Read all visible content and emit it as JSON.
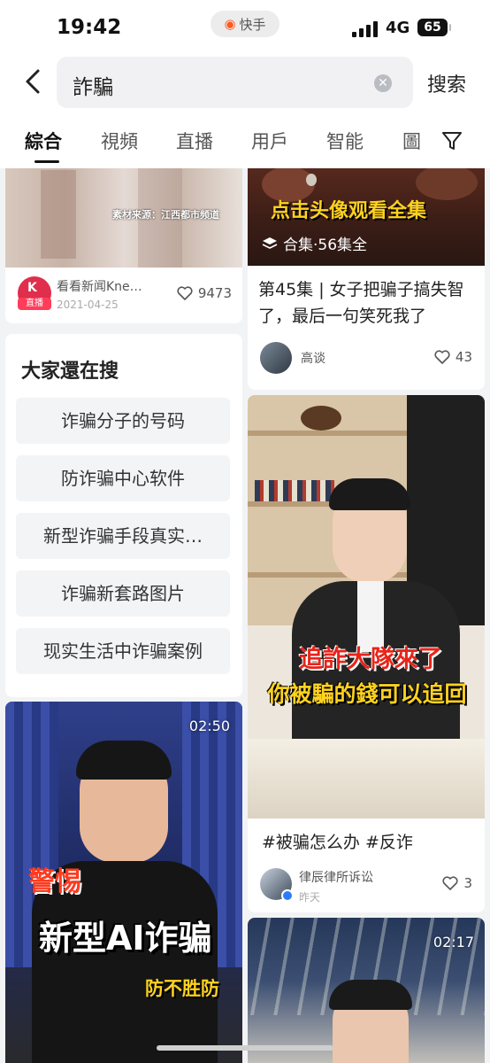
{
  "status_bar": {
    "time": "19:42",
    "app_name": "快手",
    "network": "4G",
    "battery": "65"
  },
  "search": {
    "query": "詐騙",
    "submit_label": "搜索"
  },
  "tabs": [
    {
      "label": "綜合",
      "active": true
    },
    {
      "label": "視頻",
      "active": false
    },
    {
      "label": "直播",
      "active": false
    },
    {
      "label": "用戶",
      "active": false
    },
    {
      "label": "智能",
      "active": false
    },
    {
      "label": "圖",
      "active": false
    }
  ],
  "cards": {
    "news": {
      "caption": "素材来源：江西都市频道",
      "author": "看看新闻Kne…",
      "badge": "直播",
      "date": "2021-04-25",
      "likes": "9473"
    },
    "series": {
      "overlay_title": "点击头像观看全集",
      "collection": "合集·56集全",
      "title": "第45集 | 女子把骗子搞失智了，最后一句笑死我了",
      "author": "高谈",
      "likes": "43"
    },
    "searches": {
      "title": "大家還在搜",
      "items": [
        "诈骗分子的号码",
        "防诈骗中心软件",
        "新型诈骗手段真实…",
        "诈骗新套路图片",
        "现实生活中诈骗案例"
      ]
    },
    "lawyer": {
      "overlay_line1": "追詐大隊來了",
      "overlay_line2": "你被騙的錢可以追回",
      "hashtags": "#被骗怎么办  #反诈",
      "author": "律辰律所诉讼",
      "date": "昨天",
      "likes": "3"
    },
    "ai_video": {
      "duration": "02:50",
      "tag": "警惕",
      "headline": "新型AI诈骗",
      "subline": "防不胜防"
    },
    "calligraphy_video": {
      "duration": "02:17"
    }
  },
  "colors": {
    "brand": "#ff5a22",
    "overlay_yellow": "#ffd21f",
    "overlay_red": "#e8241a"
  }
}
